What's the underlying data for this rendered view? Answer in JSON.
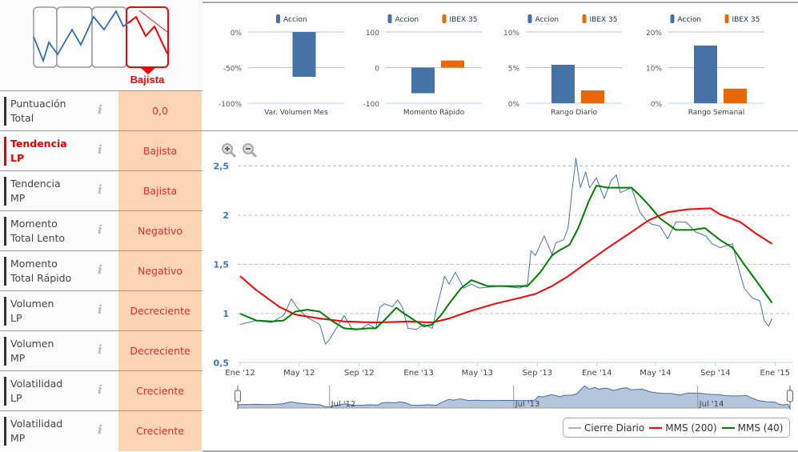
{
  "logo": {
    "label": "Bajista",
    "colors": {
      "active": "#ff0000",
      "inactive": "#999999",
      "line": "#2f6db5"
    }
  },
  "indicators": [
    {
      "label1": "Puntuación",
      "label2": "Total",
      "value": "0,0",
      "active": false
    },
    {
      "label1": "Tendencia",
      "label2": "LP",
      "value": "Bajista",
      "active": true
    },
    {
      "label1": "Tendencia",
      "label2": "MP",
      "value": "Bajista",
      "active": false
    },
    {
      "label1": "Momento",
      "label2": "Total Lento",
      "value": "Negativo",
      "active": false
    },
    {
      "label1": "Momento",
      "label2": "Total Rápido",
      "value": "Negativo",
      "active": false
    },
    {
      "label1": "Volumen",
      "label2": "LP",
      "value": "Decreciente",
      "active": false
    },
    {
      "label1": "Volumen",
      "label2": "MP",
      "value": "Decreciente",
      "active": false
    },
    {
      "label1": "Volatilidad",
      "label2": "LP",
      "value": "Creciente",
      "active": false
    },
    {
      "label1": "Volatilidad",
      "label2": "MP",
      "value": "Creciente",
      "active": false
    }
  ],
  "info_icon": "i",
  "chart_data": [
    {
      "type": "bar",
      "categories": [
        "Var. Volumen Mes"
      ],
      "series": [
        {
          "name": "Accion",
          "values": [
            -63
          ],
          "color": "#4572a7"
        }
      ],
      "yticks": [
        "0%",
        "-50%",
        "-100%"
      ],
      "ylim": [
        -100,
        0
      ]
    },
    {
      "type": "bar",
      "categories": [
        "Momento Rápido"
      ],
      "series": [
        {
          "name": "Accion",
          "values": [
            -72
          ],
          "color": "#4572a7"
        },
        {
          "name": "IBEX 35",
          "values": [
            20
          ],
          "color": "#e8690a"
        }
      ],
      "yticks": [
        "100",
        "0",
        "-100"
      ],
      "ylim": [
        -100,
        100
      ]
    },
    {
      "type": "bar",
      "categories": [
        "Rango Diario"
      ],
      "series": [
        {
          "name": "Accion",
          "values": [
            5.4
          ],
          "color": "#4572a7"
        },
        {
          "name": "IBEX 35",
          "values": [
            1.8
          ],
          "color": "#e8690a"
        }
      ],
      "yticks": [
        "10%",
        "5%",
        "0%"
      ],
      "ylim": [
        0,
        10
      ]
    },
    {
      "type": "bar",
      "categories": [
        "Rango Semanal"
      ],
      "series": [
        {
          "name": "Accion",
          "values": [
            16.2
          ],
          "color": "#4572a7"
        },
        {
          "name": "IBEX 35",
          "values": [
            4.1
          ],
          "color": "#e8690a"
        }
      ],
      "yticks": [
        "20%",
        "10%",
        "0%"
      ],
      "ylim": [
        0,
        20
      ]
    },
    {
      "type": "line",
      "ylim": [
        0.5,
        2.5
      ],
      "yticks": [
        {
          "v": 2.5,
          "label": "2,5"
        },
        {
          "v": 2,
          "label": "2"
        },
        {
          "v": 1.5,
          "label": "1,5"
        },
        {
          "v": 1,
          "label": "1"
        },
        {
          "v": 0.5,
          "label": "0,5"
        }
      ],
      "xticks": [
        {
          "d": "2012-01-01",
          "label": "Ene '12"
        },
        {
          "d": "2012-05-01",
          "label": "May '12"
        },
        {
          "d": "2012-09-01",
          "label": "Sep '12"
        },
        {
          "d": "2013-01-01",
          "label": "Ene '13"
        },
        {
          "d": "2013-05-01",
          "label": "May '13"
        },
        {
          "d": "2013-09-01",
          "label": "Sep '13"
        },
        {
          "d": "2014-01-01",
          "label": "Ene '14"
        },
        {
          "d": "2014-05-01",
          "label": "May '14"
        },
        {
          "d": "2014-09-01",
          "label": "Sep '14"
        },
        {
          "d": "2015-01-01",
          "label": "Ene '15"
        }
      ],
      "navigator_ticks": [
        {
          "d": "2012-07-01",
          "label": "Jul '12"
        },
        {
          "d": "2013-07-01",
          "label": "Jul '13"
        },
        {
          "d": "2014-07-01",
          "label": "Jul '14"
        }
      ],
      "grid": true,
      "legend_position": "bottom-right",
      "series": [
        {
          "name": "Cierre Diario",
          "color": "#4572a7",
          "points": [
            [
              "2012-01-01",
              0.89
            ],
            [
              "2012-02-03",
              0.93
            ],
            [
              "2012-03-05",
              0.91
            ],
            [
              "2012-03-30",
              0.98
            ],
            [
              "2012-04-15",
              1.15
            ],
            [
              "2012-04-27",
              1.06
            ],
            [
              "2012-05-18",
              0.96
            ],
            [
              "2012-06-12",
              0.89
            ],
            [
              "2012-06-24",
              0.69
            ],
            [
              "2012-07-01",
              0.73
            ],
            [
              "2012-07-15",
              0.84
            ],
            [
              "2012-08-01",
              0.98
            ],
            [
              "2012-08-17",
              0.85
            ],
            [
              "2012-09-03",
              0.84
            ],
            [
              "2012-09-19",
              0.89
            ],
            [
              "2012-10-05",
              0.85
            ],
            [
              "2012-10-13",
              1.06
            ],
            [
              "2012-10-22",
              1.1
            ],
            [
              "2012-11-08",
              1.07
            ],
            [
              "2012-11-19",
              1.14
            ],
            [
              "2012-11-29",
              1.06
            ],
            [
              "2012-12-10",
              0.85
            ],
            [
              "2012-12-27",
              0.84
            ],
            [
              "2013-01-12",
              0.89
            ],
            [
              "2013-01-29",
              0.85
            ],
            [
              "2013-02-07",
              1.06
            ],
            [
              "2013-02-23",
              1.38
            ],
            [
              "2013-03-04",
              1.3
            ],
            [
              "2013-03-17",
              1.42
            ],
            [
              "2013-04-03",
              1.26
            ],
            [
              "2013-04-19",
              1.3
            ],
            [
              "2013-05-05",
              1.26
            ],
            [
              "2013-06-16",
              1.28
            ],
            [
              "2013-07-27",
              1.26
            ],
            [
              "2013-08-12",
              1.3
            ],
            [
              "2013-08-19",
              1.64
            ],
            [
              "2013-08-28",
              1.59
            ],
            [
              "2013-09-15",
              1.79
            ],
            [
              "2013-10-01",
              1.6
            ],
            [
              "2013-10-09",
              1.72
            ],
            [
              "2013-10-25",
              1.75
            ],
            [
              "2013-11-03",
              1.87
            ],
            [
              "2013-11-11",
              2.24
            ],
            [
              "2013-11-19",
              2.58
            ],
            [
              "2013-11-28",
              2.28
            ],
            [
              "2013-12-09",
              2.44
            ],
            [
              "2013-12-17",
              2.28
            ],
            [
              "2013-12-31",
              2.38
            ],
            [
              "2014-01-16",
              2.17
            ],
            [
              "2014-01-30",
              2.35
            ],
            [
              "2014-02-10",
              2.41
            ],
            [
              "2014-02-18",
              2.23
            ],
            [
              "2014-03-13",
              2.28
            ],
            [
              "2014-03-30",
              2.03
            ],
            [
              "2014-04-12",
              1.95
            ],
            [
              "2014-04-23",
              1.91
            ],
            [
              "2014-05-10",
              1.89
            ],
            [
              "2014-05-26",
              1.76
            ],
            [
              "2014-06-12",
              1.93
            ],
            [
              "2014-07-03",
              1.93
            ],
            [
              "2014-07-22",
              1.83
            ],
            [
              "2014-08-12",
              1.79
            ],
            [
              "2014-08-25",
              1.71
            ],
            [
              "2014-09-10",
              1.67
            ],
            [
              "2014-10-06",
              1.71
            ],
            [
              "2014-10-13",
              1.56
            ],
            [
              "2014-10-30",
              1.26
            ],
            [
              "2014-11-15",
              1.16
            ],
            [
              "2014-12-01",
              1.13
            ],
            [
              "2014-12-10",
              0.93
            ],
            [
              "2014-12-19",
              0.87
            ],
            [
              "2014-12-26",
              0.95
            ]
          ]
        },
        {
          "name": "MMS (200)",
          "color": "#ff0000",
          "points": [
            [
              "2012-01-01",
              1.38
            ],
            [
              "2012-02-03",
              1.24
            ],
            [
              "2012-03-21",
              1.07
            ],
            [
              "2012-04-23",
              0.99
            ],
            [
              "2012-06-12",
              0.95
            ],
            [
              "2012-08-01",
              0.92
            ],
            [
              "2012-10-05",
              0.91
            ],
            [
              "2012-12-10",
              0.92
            ],
            [
              "2013-01-29",
              0.91
            ],
            [
              "2013-03-04",
              0.95
            ],
            [
              "2013-04-19",
              1.03
            ],
            [
              "2013-06-06",
              1.1
            ],
            [
              "2013-07-27",
              1.16
            ],
            [
              "2013-08-28",
              1.2
            ],
            [
              "2013-10-01",
              1.28
            ],
            [
              "2013-11-03",
              1.38
            ],
            [
              "2013-12-06",
              1.5
            ],
            [
              "2014-01-24",
              1.67
            ],
            [
              "2014-03-13",
              1.83
            ],
            [
              "2014-04-18",
              1.95
            ],
            [
              "2014-05-26",
              2.03
            ],
            [
              "2014-07-07",
              2.06
            ],
            [
              "2014-08-22",
              2.07
            ],
            [
              "2014-09-10",
              2.01
            ],
            [
              "2014-10-22",
              1.93
            ],
            [
              "2014-11-24",
              1.81
            ],
            [
              "2014-12-26",
              1.71
            ]
          ]
        },
        {
          "name": "MMS (40)",
          "color": "#008000",
          "points": [
            [
              "2012-01-01",
              1.0
            ],
            [
              "2012-02-03",
              0.93
            ],
            [
              "2012-03-05",
              0.92
            ],
            [
              "2012-03-30",
              0.93
            ],
            [
              "2012-04-23",
              1.02
            ],
            [
              "2012-05-18",
              1.04
            ],
            [
              "2012-06-12",
              1.02
            ],
            [
              "2012-07-06",
              0.93
            ],
            [
              "2012-08-01",
              0.85
            ],
            [
              "2012-08-25",
              0.84
            ],
            [
              "2012-09-19",
              0.85
            ],
            [
              "2012-10-05",
              0.85
            ],
            [
              "2012-10-22",
              0.93
            ],
            [
              "2012-11-16",
              1.06
            ],
            [
              "2012-12-02",
              1.0
            ],
            [
              "2012-12-27",
              0.92
            ],
            [
              "2013-01-12",
              0.87
            ],
            [
              "2013-01-29",
              0.89
            ],
            [
              "2013-02-15",
              0.98
            ],
            [
              "2013-03-04",
              1.1
            ],
            [
              "2013-03-29",
              1.26
            ],
            [
              "2013-04-19",
              1.34
            ],
            [
              "2013-05-22",
              1.28
            ],
            [
              "2013-06-25",
              1.28
            ],
            [
              "2013-08-12",
              1.28
            ],
            [
              "2013-09-07",
              1.42
            ],
            [
              "2013-10-01",
              1.59
            ],
            [
              "2013-10-12",
              1.63
            ],
            [
              "2013-11-06",
              1.7
            ],
            [
              "2013-11-24",
              1.87
            ],
            [
              "2013-12-16",
              2.15
            ],
            [
              "2013-12-31",
              2.3
            ],
            [
              "2014-01-24",
              2.28
            ],
            [
              "2014-02-18",
              2.28
            ],
            [
              "2014-03-13",
              2.28
            ],
            [
              "2014-03-30",
              2.2
            ],
            [
              "2014-04-18",
              2.1
            ],
            [
              "2014-05-10",
              1.97
            ],
            [
              "2014-06-12",
              1.85
            ],
            [
              "2014-07-16",
              1.85
            ],
            [
              "2014-08-10",
              1.87
            ],
            [
              "2014-09-10",
              1.75
            ],
            [
              "2014-10-06",
              1.67
            ],
            [
              "2014-10-30",
              1.5
            ],
            [
              "2014-11-24",
              1.33
            ],
            [
              "2014-12-26",
              1.11
            ]
          ]
        }
      ]
    }
  ]
}
